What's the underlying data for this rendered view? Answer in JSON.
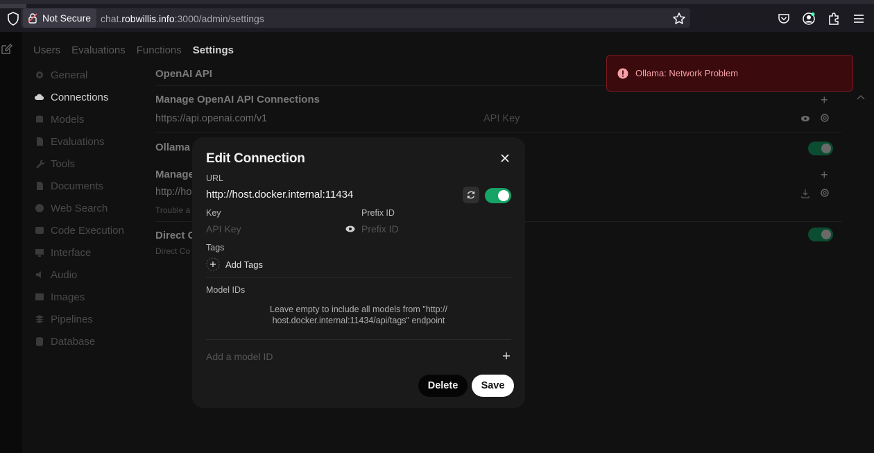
{
  "browser": {
    "security_label": "Not Secure",
    "url_prefix": "chat.",
    "url_host": "robwillis.info",
    "url_suffix": ":3000/admin/settings"
  },
  "admin_tabs": [
    {
      "label": "Users"
    },
    {
      "label": "Evaluations"
    },
    {
      "label": "Functions"
    },
    {
      "label": "Settings"
    }
  ],
  "sidebar": {
    "items": [
      {
        "label": "General",
        "icon": "gear-icon"
      },
      {
        "label": "Connections",
        "icon": "cloud-icon"
      },
      {
        "label": "Models",
        "icon": "cube-icon"
      },
      {
        "label": "Evaluations",
        "icon": "document-icon"
      },
      {
        "label": "Tools",
        "icon": "wrench-icon"
      },
      {
        "label": "Documents",
        "icon": "document-icon"
      },
      {
        "label": "Web Search",
        "icon": "globe-icon"
      },
      {
        "label": "Code Execution",
        "icon": "code-icon"
      },
      {
        "label": "Interface",
        "icon": "monitor-icon"
      },
      {
        "label": "Audio",
        "icon": "speaker-icon"
      },
      {
        "label": "Images",
        "icon": "image-icon"
      },
      {
        "label": "Pipelines",
        "icon": "stack-icon"
      },
      {
        "label": "Database",
        "icon": "database-icon"
      }
    ]
  },
  "main": {
    "openai_title": "OpenAI API",
    "manage_openai": "Manage OpenAI API Connections",
    "openai_url": "https://api.openai.com/v1",
    "openai_key_placeholder": "API Key",
    "ollama_title_partial": "Ollama /",
    "manage_partial": "Manage",
    "ollama_url_partial": "http://ho",
    "trouble_partial": "Trouble a",
    "direct_title_partial": "Direct C",
    "direct_desc_partial": "Direct Co"
  },
  "toast": {
    "message": "Ollama: Network Problem",
    "color": "#f6a0a5"
  },
  "modal": {
    "title": "Edit Connection",
    "url_label": "URL",
    "url_value": "http://host.docker.internal:11434",
    "key_label": "Key",
    "key_placeholder": "API Key",
    "prefix_label": "Prefix ID",
    "prefix_placeholder": "Prefix ID",
    "tags_label": "Tags",
    "add_tags": "Add Tags",
    "model_ids_label": "Model IDs",
    "model_hint_line1": "Leave empty to include all models from \"http://",
    "model_hint_line2": "host.docker.internal:11434/api/tags\" endpoint",
    "add_model_placeholder": "Add a model ID",
    "delete_label": "Delete",
    "save_label": "Save",
    "toggle_enabled": true,
    "accent_color": "#16a366"
  }
}
